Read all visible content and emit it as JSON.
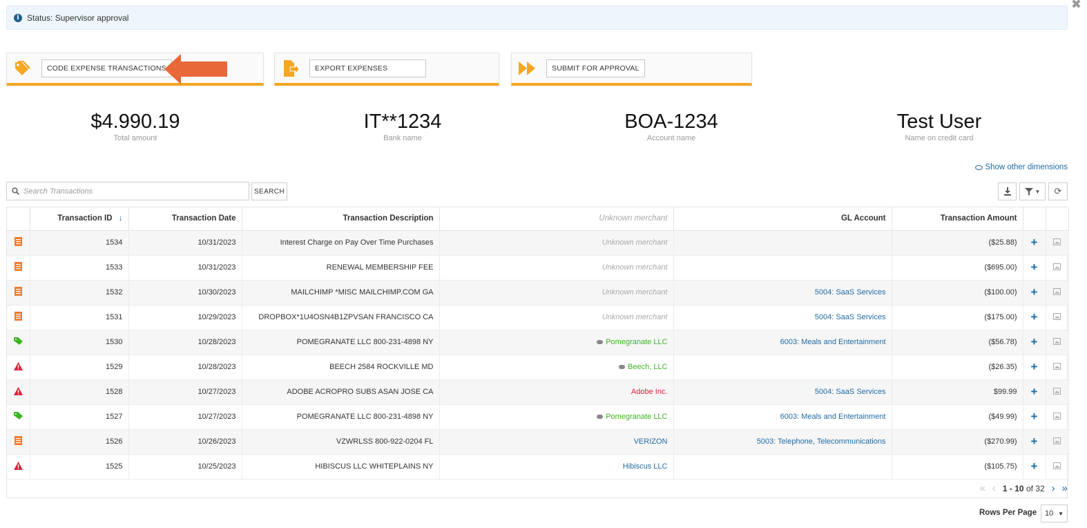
{
  "status": {
    "text": "Status: Supervisor approval"
  },
  "actions": {
    "code": "CODE EXPENSE TRANSACTIONS",
    "export": "EXPORT EXPENSES",
    "submit": "SUBMIT FOR APPROVAL"
  },
  "stats": [
    {
      "value": "$4.990.19",
      "label": "Total amount"
    },
    {
      "value": "IT**1234",
      "label": "Bank name"
    },
    {
      "value": "BOA-1234",
      "label": "Account name"
    },
    {
      "value": "Test User",
      "label": "Name on credit card"
    }
  ],
  "show_dimensions": "Show other dimensions",
  "search": {
    "placeholder": "Search Transactions",
    "button": "SEARCH"
  },
  "table": {
    "headers": {
      "id": "Transaction ID",
      "date": "Transaction Date",
      "desc": "Transaction Description",
      "merchant": "Unknown merchant",
      "gl": "GL Account",
      "amount": "Transaction Amount"
    },
    "rows": [
      {
        "icon": "receipt-icon",
        "id": "1534",
        "date": "10/31/2023",
        "desc": "Interest Charge on Pay Over Time Purchases",
        "merchant": "Unknown merchant",
        "merchant_style": "unknown",
        "gl": "",
        "amount": "($25.88)"
      },
      {
        "icon": "receipt-icon",
        "id": "1533",
        "date": "10/31/2023",
        "desc": "RENEWAL MEMBERSHIP FEE",
        "merchant": "Unknown merchant",
        "merchant_style": "unknown",
        "gl": "",
        "amount": "($695.00)"
      },
      {
        "icon": "receipt-icon",
        "id": "1532",
        "date": "10/30/2023",
        "desc": "MAILCHIMP *MISC MAILCHIMP.COM GA",
        "merchant": "Unknown merchant",
        "merchant_style": "unknown",
        "gl": "5004: SaaS Services",
        "amount": "($100.00)"
      },
      {
        "icon": "receipt-icon",
        "id": "1531",
        "date": "10/29/2023",
        "desc": "DROPBOX*1U4OSN4B1ZPVSAN FRANCISCO CA",
        "merchant": "Unknown merchant",
        "merchant_style": "unknown",
        "gl": "5004: SaaS Services",
        "amount": "($175.00)"
      },
      {
        "icon": "tag-icon",
        "id": "1530",
        "date": "10/28/2023",
        "desc": "POMEGRANATE LLC 800-231-4898 NY",
        "merchant": "Pomegranate LLC",
        "merchant_style": "green",
        "gl": "6003: Meals and Entertainment",
        "amount": "($56.78)"
      },
      {
        "icon": "warning-icon",
        "id": "1529",
        "date": "10/28/2023",
        "desc": "BEECH 2584 ROCKVILLE MD",
        "merchant": "Beech, LLC",
        "merchant_style": "green",
        "gl": "",
        "amount": "($26.35)"
      },
      {
        "icon": "warning-icon",
        "id": "1528",
        "date": "10/27/2023",
        "desc": "ADOBE ACROPRO SUBS ASAN JOSE CA",
        "merchant": "Adobe Inc.",
        "merchant_style": "red",
        "gl": "5004: SaaS Services",
        "amount": "$99.99"
      },
      {
        "icon": "tag-icon",
        "id": "1527",
        "date": "10/27/2023",
        "desc": "POMEGRANATE LLC 800-231-4898 NY",
        "merchant": "Pomegranate LLC",
        "merchant_style": "green",
        "gl": "6003: Meals and Entertainment",
        "amount": "($49.99)"
      },
      {
        "icon": "receipt-icon",
        "id": "1526",
        "date": "10/26/2023",
        "desc": "VZWRLSS 800-922-0204 FL",
        "merchant": "VERIZON",
        "merchant_style": "blue",
        "gl": "5003: Telephone, Telecommunications",
        "amount": "($270.99)"
      },
      {
        "icon": "warning-icon",
        "id": "1525",
        "date": "10/25/2023",
        "desc": "HIBISCUS LLC WHITEPLAINS NY",
        "merchant": "Hibiscus LLC",
        "merchant_style": "blue",
        "gl": "",
        "amount": "($105.75)"
      }
    ]
  },
  "pagination": {
    "range": "1 - 10",
    "of_label": "of 32"
  },
  "rows_per_page": {
    "label": "Rows Per Page",
    "value": "10"
  },
  "colors": {
    "accent_orange": "#f5a623",
    "link_blue": "#1f6aa5",
    "green": "#3cb521",
    "red": "#d9243a"
  }
}
